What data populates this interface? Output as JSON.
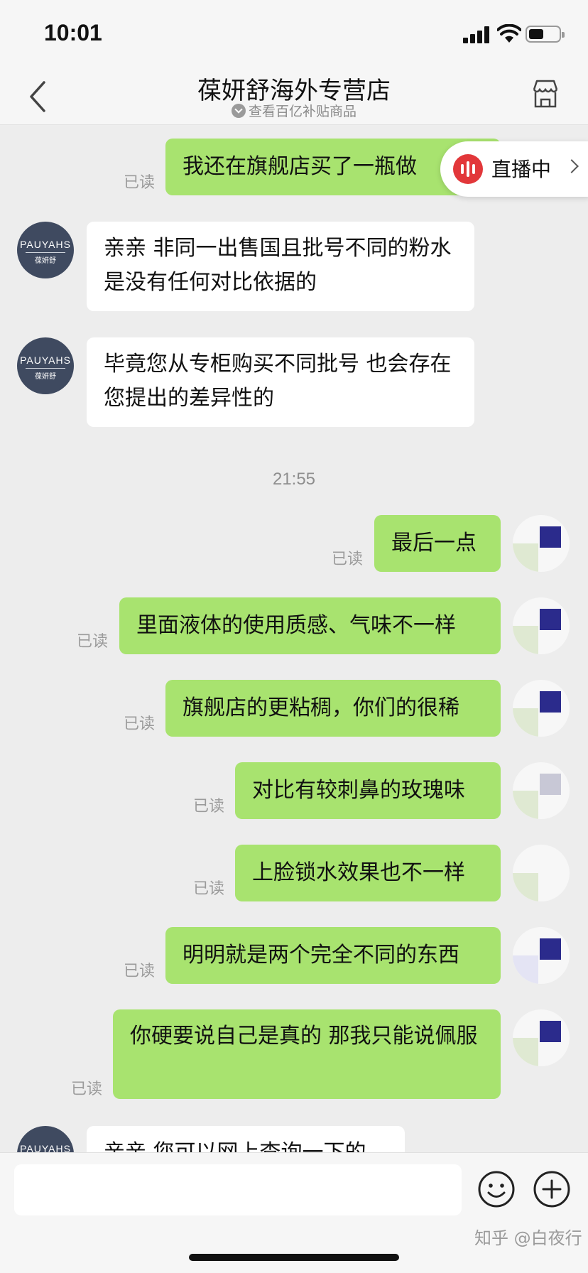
{
  "status_bar": {
    "time": "10:01"
  },
  "nav": {
    "title": "葆妍舒海外专营店",
    "subtitle": "查看百亿补贴商品"
  },
  "live_badge": {
    "label": "直播中"
  },
  "avatar_brand": {
    "latin": "PAUYAHS",
    "cn": "葆妍舒"
  },
  "messages": [
    {
      "side": "me",
      "text": "我还在旗舰店买了一瓶做",
      "read": "已读"
    },
    {
      "side": "them",
      "text": "亲亲 非同一出售国且批号不同的粉水是没有任何对比依据的"
    },
    {
      "side": "them",
      "text": "毕竟您从专柜购买不同批号 也会存在您提出的差异性的"
    },
    {
      "side": "time",
      "text": "21:55"
    },
    {
      "side": "me",
      "text": "最后一点",
      "read": "已读"
    },
    {
      "side": "me",
      "text": "里面液体的使用质感、气味不一样",
      "read": "已读"
    },
    {
      "side": "me",
      "text": "旗舰店的更粘稠，你们的很稀",
      "read": "已读"
    },
    {
      "side": "me",
      "text": "对比有较刺鼻的玫瑰味",
      "read": "已读"
    },
    {
      "side": "me",
      "text": "上脸锁水效果也不一样",
      "read": "已读"
    },
    {
      "side": "me",
      "text": "明明就是两个完全不同的东西",
      "read": "已读"
    },
    {
      "side": "me",
      "text": "你硬要说自己是真的 那我只能说佩服",
      "read": "已读"
    },
    {
      "side": "them",
      "text": "亲亲 您可以网上查询一下的"
    }
  ],
  "input": {
    "value": "",
    "placeholder": ""
  },
  "watermark": "知乎 @白夜行",
  "colors": {
    "my_bubble": "#a8e36f",
    "their_bubble": "#ffffff",
    "background": "#ededed",
    "live_red": "#e2373a",
    "avatar": "#3f4a60"
  }
}
